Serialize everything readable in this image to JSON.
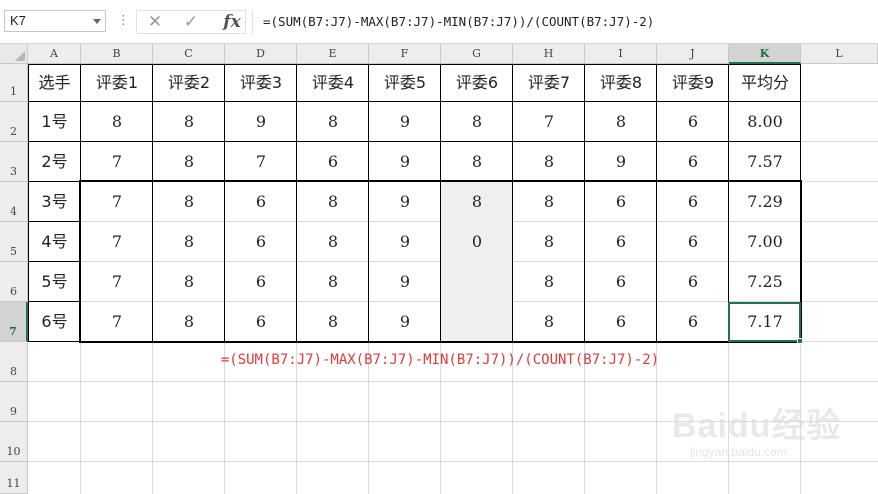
{
  "formula_bar": {
    "name_box": "K7",
    "cancel_icon": "✕",
    "enter_icon": "✓",
    "fx_label": "fx",
    "formula": "=(SUM(B7:J7)-MAX(B7:J7)-MIN(B7:J7))/(COUNT(B7:J7)-2)"
  },
  "columns": [
    "A",
    "B",
    "C",
    "D",
    "E",
    "F",
    "G",
    "H",
    "I",
    "J",
    "K",
    "L"
  ],
  "selected_column": "K",
  "rows": [
    "1",
    "2",
    "3",
    "4",
    "5",
    "6",
    "7",
    "8",
    "9",
    "10",
    "11"
  ],
  "selected_row": "7",
  "table": {
    "headers": [
      "选手",
      "评委1",
      "评委2",
      "评委3",
      "评委4",
      "评委5",
      "评委6",
      "评委7",
      "评委8",
      "评委9",
      "平均分"
    ],
    "data": [
      [
        "1号",
        "8",
        "8",
        "9",
        "8",
        "9",
        "8",
        "7",
        "8",
        "6",
        "8.00"
      ],
      [
        "2号",
        "7",
        "8",
        "7",
        "6",
        "9",
        "8",
        "8",
        "9",
        "6",
        "7.57"
      ],
      [
        "3号",
        "7",
        "8",
        "6",
        "8",
        "9",
        "8",
        "8",
        "6",
        "6",
        "7.29"
      ],
      [
        "4号",
        "7",
        "8",
        "6",
        "8",
        "9",
        "0",
        "8",
        "6",
        "6",
        "7.00"
      ],
      [
        "5号",
        "7",
        "8",
        "6",
        "8",
        "9",
        "",
        "8",
        "6",
        "6",
        "7.25"
      ],
      [
        "6号",
        "7",
        "8",
        "6",
        "8",
        "9",
        "",
        "8",
        "6",
        "6",
        "7.17"
      ]
    ]
  },
  "annotation": "=(SUM(B7:J7)-MAX(B7:J7)-MIN(B7:J7))/(COUNT(B7:J7)-2)",
  "colors": {
    "accent": "#217346",
    "annotation": "#e03a3a",
    "highlight": "#efefef"
  },
  "watermark": {
    "logo": "Baidu经验",
    "url": "jingyan.baidu.com"
  }
}
